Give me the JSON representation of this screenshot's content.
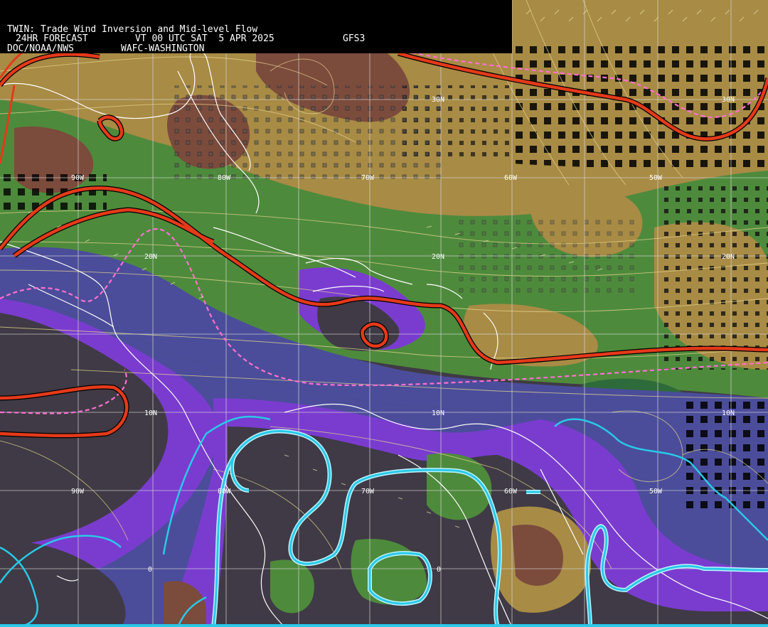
{
  "header": {
    "line1": "TWIN: Trade Wind Inversion and Mid-level Flow",
    "line2a": "24HR FORECAST",
    "line2b": "VT 00 UTC SAT  5 APR 2025",
    "line2c": "GFS3",
    "line3a": "DOC/NOAA/NWS",
    "line3b": "WAFC-WASHINGTON"
  },
  "grid_labels": {
    "lat_30n": "30N",
    "lat_30n_e": "30N",
    "lat_20n_w": "20N",
    "lat_20n_c": "20N",
    "lat_20n_e": "20N",
    "lat_10n_w": "10N",
    "lat_10n_c": "10N",
    "lat_10n_e": "10N",
    "lat_0_w": "0",
    "lat_0_c": "0",
    "lon_90w_n": "90W",
    "lon_80w_n": "80W",
    "lon_70w_n": "70W",
    "lon_60w_n": "60W",
    "lon_50w_n": "50W",
    "lon_90w_s": "90W",
    "lon_80w_s": "80W",
    "lon_70w_s": "70W",
    "lon_60w_s": "60W",
    "lon_50w_s": "50W"
  },
  "colors": {
    "background": "#3f3a45",
    "dark_brown": "#7b4b3c",
    "tan": "#a88b45",
    "green": "#4e8a3c",
    "dark_green": "#2e6b3a",
    "slate_blue": "#4b4d9a",
    "purple": "#7a3ccf",
    "red_contour": "#e43a1a",
    "magenta_dash": "#ff6fd0",
    "cyan_contour": "#29c9e8",
    "streamline": "#e8d890",
    "gridline": "#d8d8d8"
  }
}
